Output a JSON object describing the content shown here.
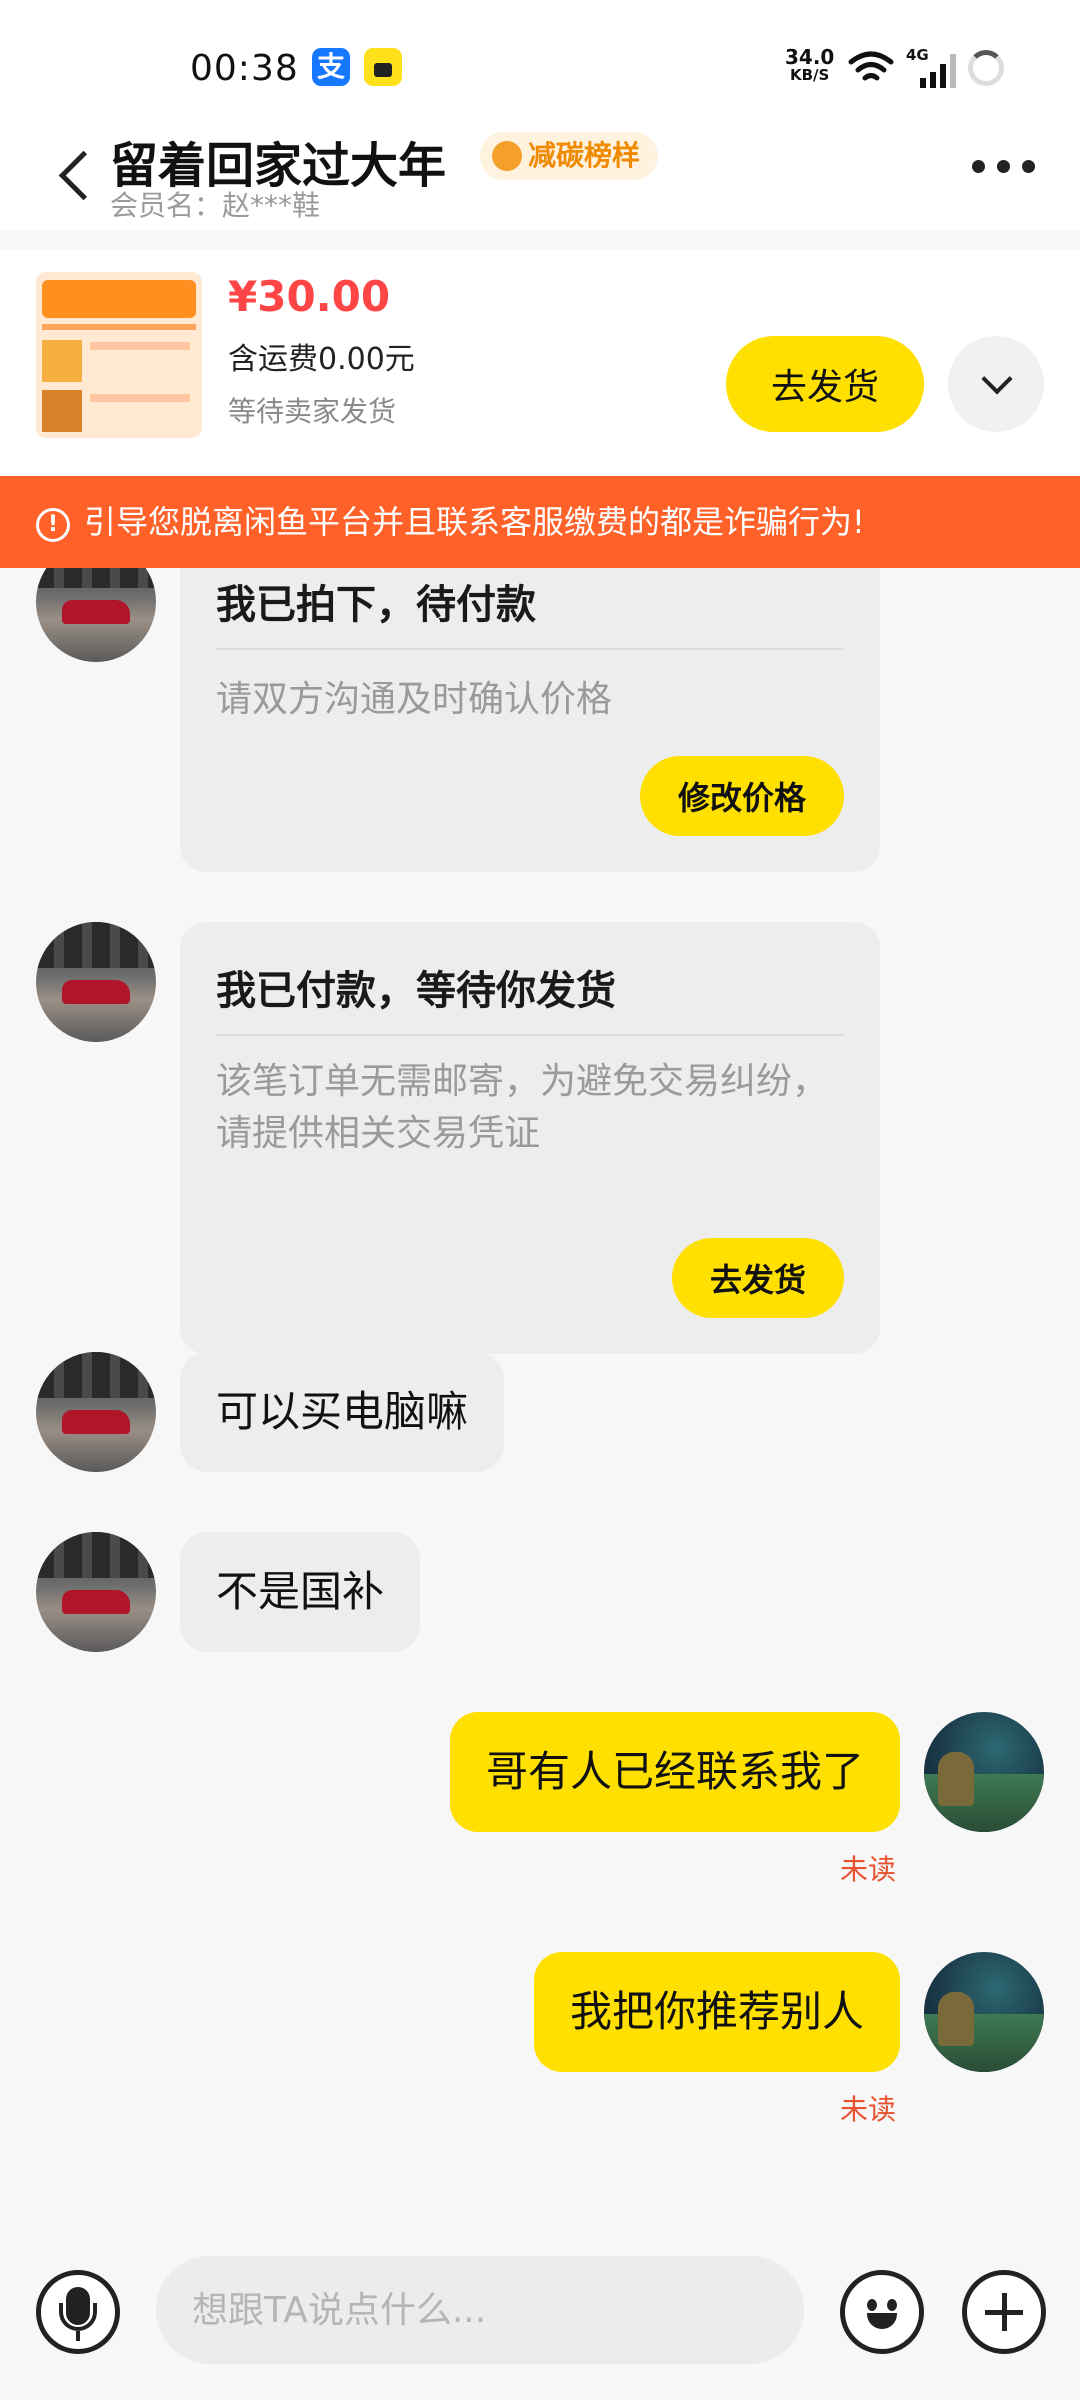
{
  "status_bar": {
    "time": "00:38",
    "net_speed": "34.0",
    "net_unit": "KB/S",
    "network_type": "4G",
    "apps": [
      "alipay-icon",
      "xianyu-icon"
    ]
  },
  "header": {
    "title": "留着回家过大年",
    "badge": "减碳榜样",
    "member": "会员名：赵***鞋"
  },
  "order": {
    "price": "¥30.00",
    "shipping": "含运费0.00元",
    "status": "等待卖家发货",
    "ship_button": "去发货"
  },
  "warning": {
    "text": "引导您脱离闲鱼平台并且联系客服缴费的都是诈骗行为!"
  },
  "messages": {
    "card1": {
      "title": "我已拍下，待付款",
      "desc": "请双方沟通及时确认价格",
      "button": "修改价格"
    },
    "card2": {
      "title": "我已付款，等待你发货",
      "desc": "该笔订单无需邮寄，为避免交易纠纷，请提供相关交易凭证",
      "button": "去发货"
    },
    "in1": "可以买电脑嘛",
    "in2": "不是国补",
    "out1": "哥有人已经联系我了",
    "out1_status": "未读",
    "out2": "我把你推荐别人",
    "out2_status": "未读"
  },
  "input": {
    "placeholder": "想跟TA说点什么..."
  },
  "colors": {
    "accent_yellow": "#ffe000",
    "price_red": "#ff4545",
    "warning_orange": "#ff6128",
    "unread_red": "#e8502e"
  }
}
